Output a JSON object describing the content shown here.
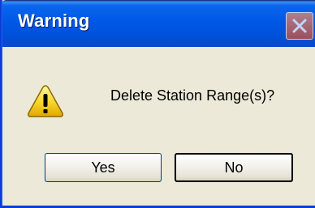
{
  "window": {
    "title": "Warning"
  },
  "dialog": {
    "message": "Delete Station Range(s)?",
    "icon": "warning-icon"
  },
  "buttons": {
    "yes_label": "Yes",
    "no_label": "No"
  },
  "colors": {
    "titlebar": "#0058E6",
    "dialog_background": "#ECE9D8",
    "warning_yellow": "#F8D830"
  }
}
